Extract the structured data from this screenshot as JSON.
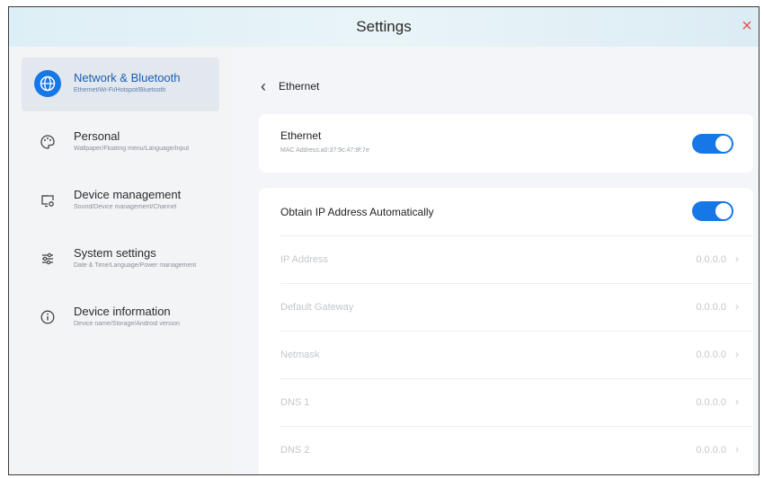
{
  "window": {
    "title": "Settings",
    "close_glyph": "×"
  },
  "sidebar": {
    "items": [
      {
        "label": "Network & Bluetooth",
        "sub": "Ethernet/Wi-Fi/Hotspot/Bluetooth",
        "icon": "globe-icon",
        "active": true
      },
      {
        "label": "Personal",
        "sub": "Wallpaper/Floating menu/Language/Input",
        "icon": "palette-icon",
        "active": false
      },
      {
        "label": "Device management",
        "sub": "Sound/Device management/Channel",
        "icon": "monitor-icon",
        "active": false
      },
      {
        "label": "System settings",
        "sub": "Date & Time/Language/Power management",
        "icon": "sliders-icon",
        "active": false
      },
      {
        "label": "Device information",
        "sub": "Device name/Storage/Android version",
        "icon": "info-icon",
        "active": false
      }
    ]
  },
  "main": {
    "breadcrumb": "Ethernet",
    "ethernet": {
      "title": "Ethernet",
      "sub": "MAC Address:a0:37:9c:47:9f:7e",
      "enabled": true
    },
    "auto_ip": {
      "title": "Obtain IP Address Automatically",
      "enabled": true
    },
    "rows": [
      {
        "label": "IP Address",
        "value": "0.0.0.0"
      },
      {
        "label": "Default Gateway",
        "value": "0.0.0.0"
      },
      {
        "label": "Netmask",
        "value": "0.0.0.0"
      },
      {
        "label": "DNS 1",
        "value": "0.0.0.0"
      },
      {
        "label": "DNS 2",
        "value": "0.0.0.0"
      }
    ]
  },
  "colors": {
    "accent": "#1677e6",
    "close": "#e0574f",
    "disabled_text": "#c3c7cc"
  }
}
